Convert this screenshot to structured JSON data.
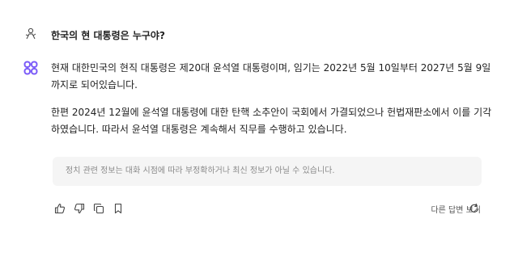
{
  "question": "한국의 현 대통령은 누구야?",
  "answer": {
    "paragraph1": "현재 대한민국의 현직 대통령은 제20대 윤석열 대통령이며, 임기는 2022년 5월 10일부터 2027년 5월 9일까지로 되어있습니다.",
    "paragraph2": "한편 2024년 12월에 윤석열 대통령에 대한 탄핵 소추안이 국회에서 가결되었으나 헌법재판소에서 이를 기각하였습니다. 따라서 윤석열 대통령은 계속해서 직무를 수행하고 있습니다."
  },
  "notice": "정치 관련 정보는 대화 시점에 따라 부정확하거나 최신 정보가 아닐 수 있습니다.",
  "other_answers_label": "다른 답변 보기",
  "icons": {
    "user": "user-avatar-icon",
    "bot": "assistant-logo-icon",
    "actions": [
      "thumbs-up-icon",
      "thumbs-down-icon",
      "copy-icon",
      "bookmark-icon"
    ],
    "regenerate": "refresh-icon"
  },
  "colors": {
    "logo": "#7a5af8"
  }
}
